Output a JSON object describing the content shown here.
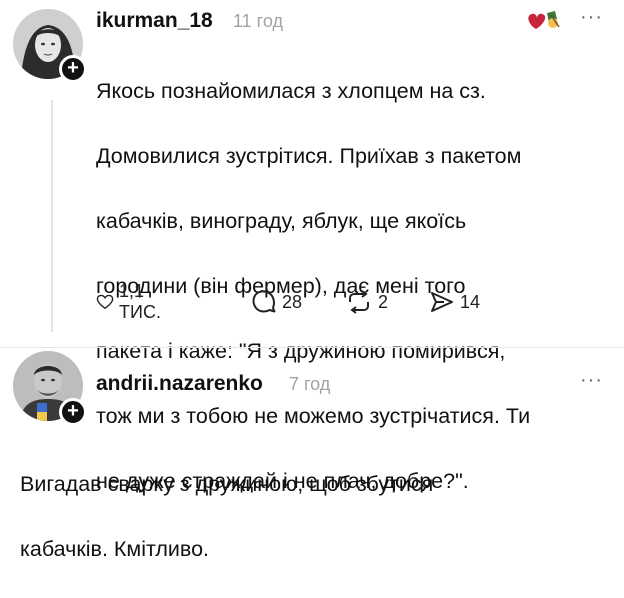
{
  "post": {
    "username": "ikurman_18",
    "time": "11 год",
    "more": "···",
    "text_lines": [
      "Якось познайомилася з хлопцем на сз.",
      "Домовилися зустрітися. Приїхав з пакетом",
      "кабачків, винограду, яблук, ще якоїсь",
      "городини (він фермер), дає мені того",
      "пакета і каже: \"Я з дружиною помирився,",
      "тож ми з тобою не можемо зустрічатися. Ти",
      "не дуже страждай і не плач, добре?\"."
    ],
    "likes": "1,1 ТИС.",
    "comments": "28",
    "reposts": "2",
    "shares": "14",
    "heart_icon": "heart-icon",
    "comment_icon": "comment-icon",
    "repost_icon": "repost-icon",
    "share_icon": "share-icon"
  },
  "reply": {
    "username": "andrii.nazarenko",
    "time": "7 год",
    "more": "···",
    "text_lines": [
      "Вигадав сварку з дружиною, щоб збутися",
      "кабачків. Кмітливо."
    ]
  },
  "colors": {
    "accent_heart": "#c8243a",
    "muted_text": "#a3a3a3"
  }
}
